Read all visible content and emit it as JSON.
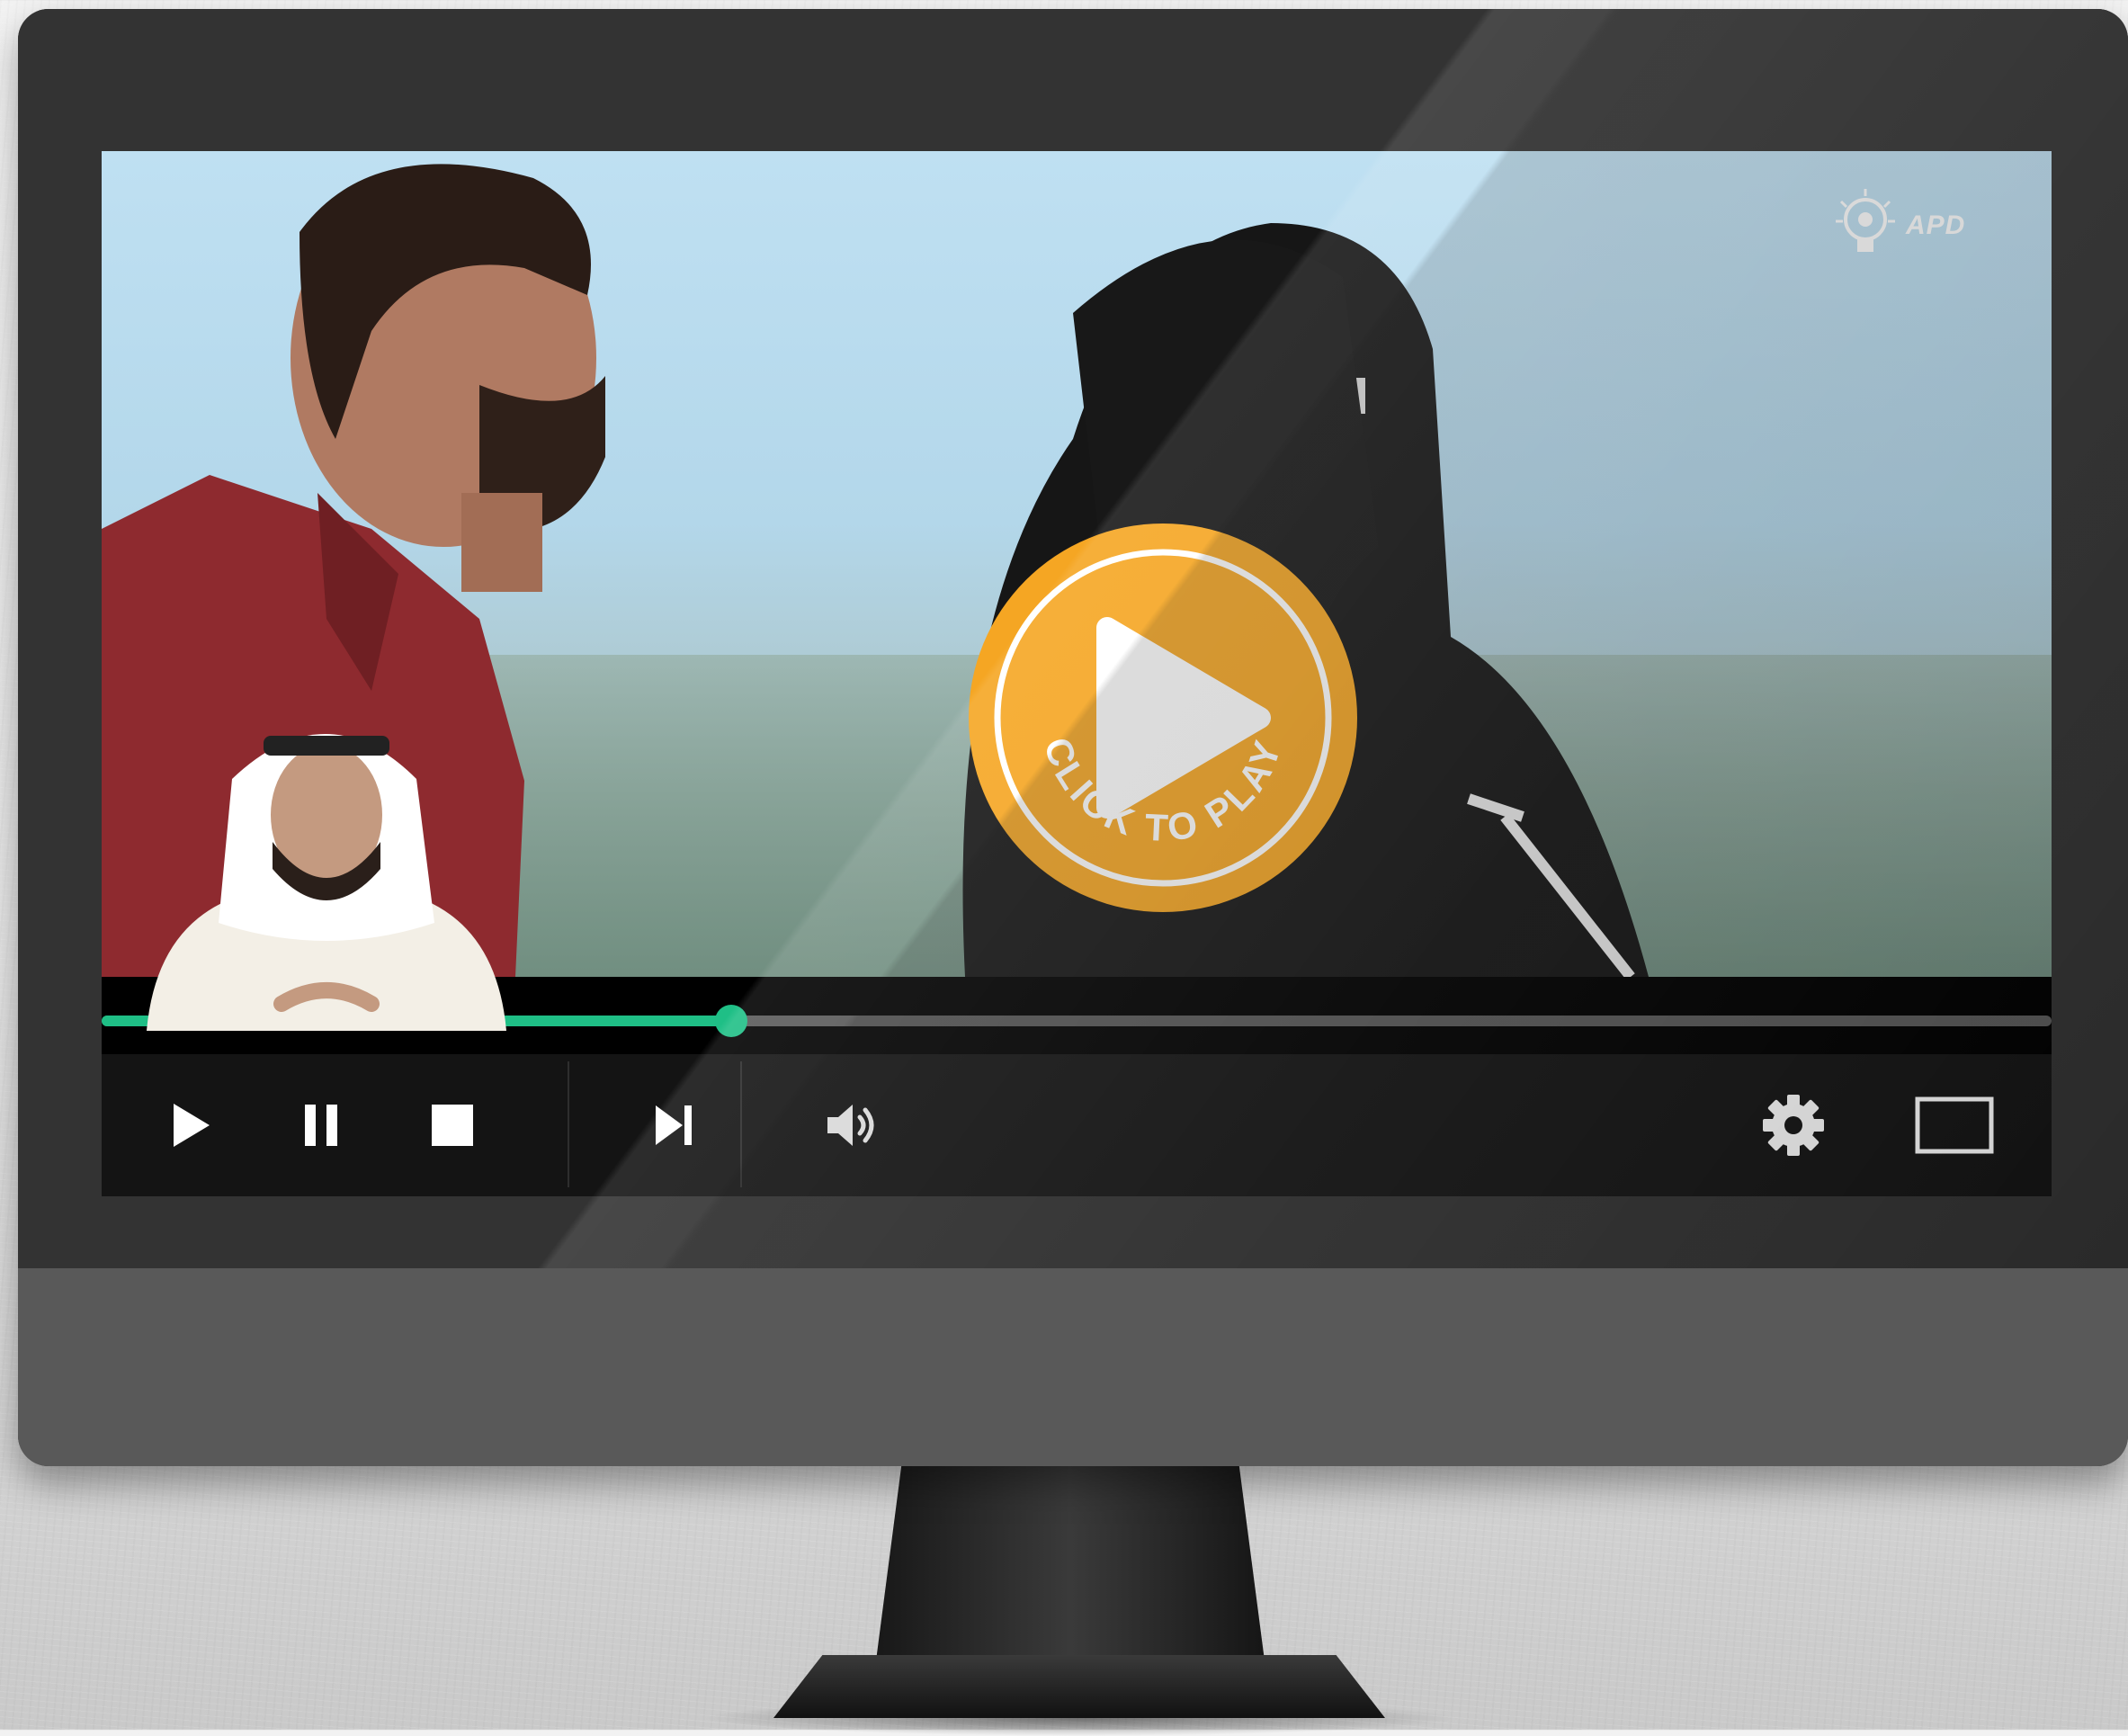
{
  "overlay": {
    "play_badge_text": "CLICK TO PLAY"
  },
  "logo": {
    "abbr": "APD"
  },
  "player": {
    "progress": 0.323,
    "colors": {
      "accent": "#1fbf86",
      "badge": "#f5a623"
    },
    "controls": {
      "play": "play-icon",
      "pause": "pause-icon",
      "stop": "stop-icon",
      "next": "skip-next-icon",
      "volume": "volume-icon",
      "settings": "gear-icon",
      "fullscreen": "fullscreen-icon"
    }
  }
}
